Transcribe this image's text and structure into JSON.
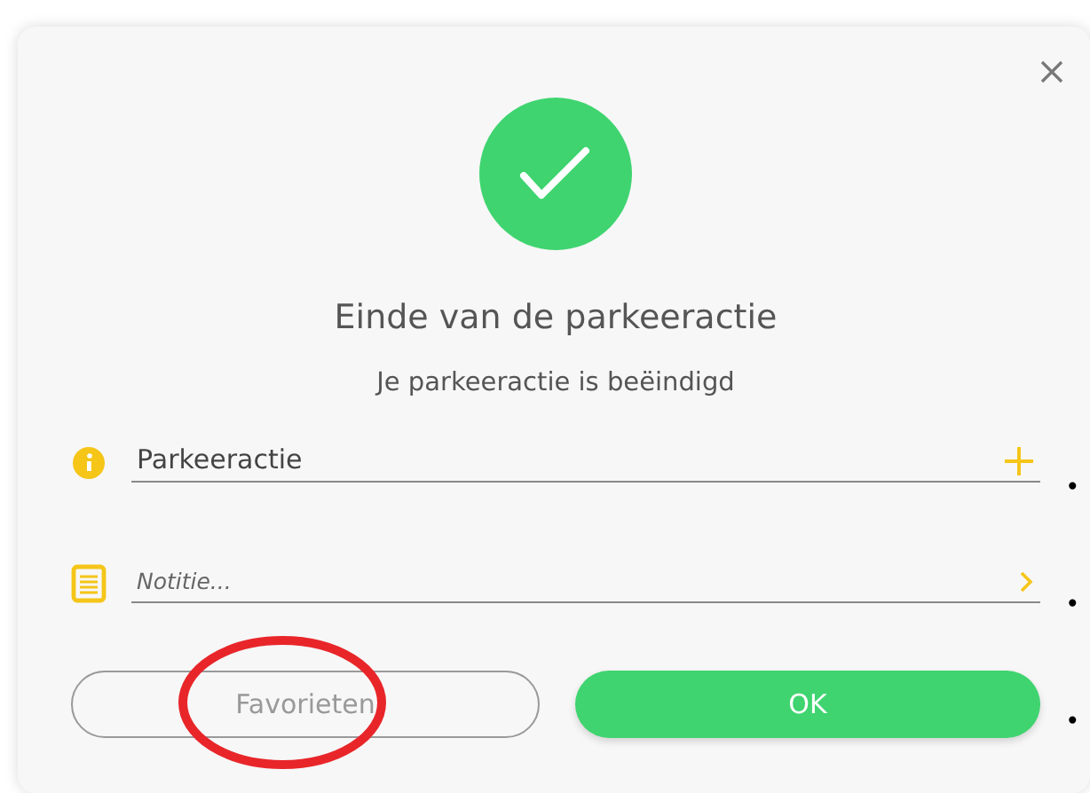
{
  "dialog": {
    "title": "Einde van de parkeeractie",
    "subtitle": "Je parkeeractie is beëindigd",
    "fields": [
      {
        "kind": "info",
        "value": "Parkeeractie"
      },
      {
        "kind": "note",
        "placeholder": "Notitie..."
      }
    ],
    "buttons": [
      {
        "label": "Favorieten",
        "kind": "secondary"
      },
      {
        "label": "OK",
        "kind": "primary"
      }
    ]
  },
  "background_marks": [
    "•",
    "•",
    "•"
  ],
  "annotation": {
    "kind": "ellipse"
  }
}
